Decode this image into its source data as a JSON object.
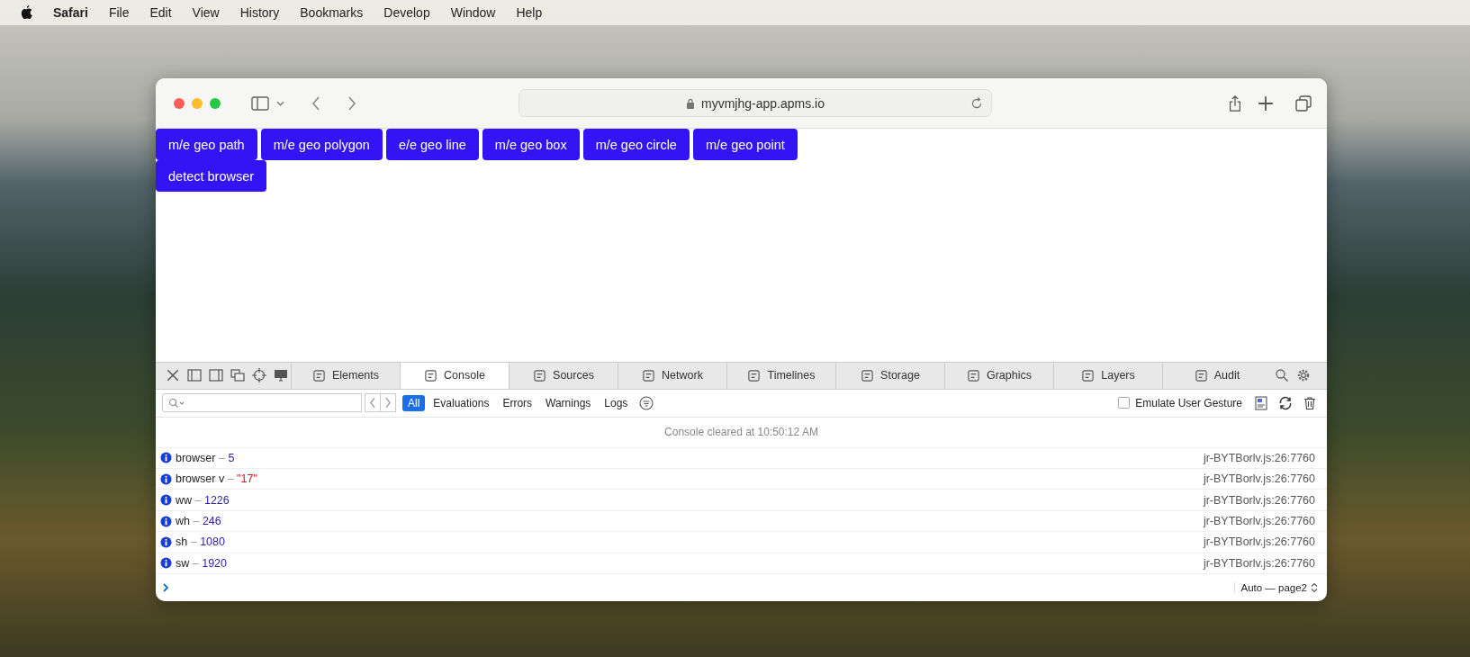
{
  "menu_bar": {
    "app": "Safari",
    "items": [
      "File",
      "Edit",
      "View",
      "History",
      "Bookmarks",
      "Develop",
      "Window",
      "Help"
    ]
  },
  "browser": {
    "address": "myvmjhg-app.apms.io"
  },
  "page": {
    "button_rows": [
      [
        "m/e geo path",
        "m/e geo polygon",
        "e/e geo line",
        "m/e geo box",
        "m/e geo circle",
        "m/e geo point"
      ],
      [
        "detect browser"
      ]
    ]
  },
  "devtools": {
    "tabs": [
      {
        "label": "Elements",
        "selected": false
      },
      {
        "label": "Console",
        "selected": true
      },
      {
        "label": "Sources",
        "selected": false
      },
      {
        "label": "Network",
        "selected": false
      },
      {
        "label": "Timelines",
        "selected": false
      },
      {
        "label": "Storage",
        "selected": false
      },
      {
        "label": "Graphics",
        "selected": false
      },
      {
        "label": "Layers",
        "selected": false
      },
      {
        "label": "Audit",
        "selected": false
      }
    ],
    "filters": [
      {
        "label": "All",
        "selected": true
      },
      {
        "label": "Evaluations",
        "selected": false
      },
      {
        "label": "Errors",
        "selected": false
      },
      {
        "label": "Warnings",
        "selected": false
      },
      {
        "label": "Logs",
        "selected": false
      }
    ],
    "emulate_gesture": {
      "label": "Emulate User Gesture",
      "checked": false
    },
    "cleared_message": "Console cleared at 10:50:12 AM",
    "messages": [
      {
        "name": "browser",
        "separator": "–",
        "value": "5",
        "kind": "number",
        "source": "jr-BYTBorlv.js:26:7760"
      },
      {
        "name": "browser v",
        "separator": "–",
        "value": "\"17\"",
        "kind": "string",
        "source": "jr-BYTBorlv.js:26:7760"
      },
      {
        "name": "ww",
        "separator": "–",
        "value": "1226",
        "kind": "number",
        "source": "jr-BYTBorlv.js:26:7760"
      },
      {
        "name": "wh",
        "separator": "–",
        "value": "246",
        "kind": "number",
        "source": "jr-BYTBorlv.js:26:7760"
      },
      {
        "name": "sh",
        "separator": "–",
        "value": "1080",
        "kind": "number",
        "source": "jr-BYTBorlv.js:26:7760"
      },
      {
        "name": "sw",
        "separator": "–",
        "value": "1920",
        "kind": "number",
        "source": "jr-BYTBorlv.js:26:7760"
      }
    ],
    "context": "Auto — page2"
  }
}
